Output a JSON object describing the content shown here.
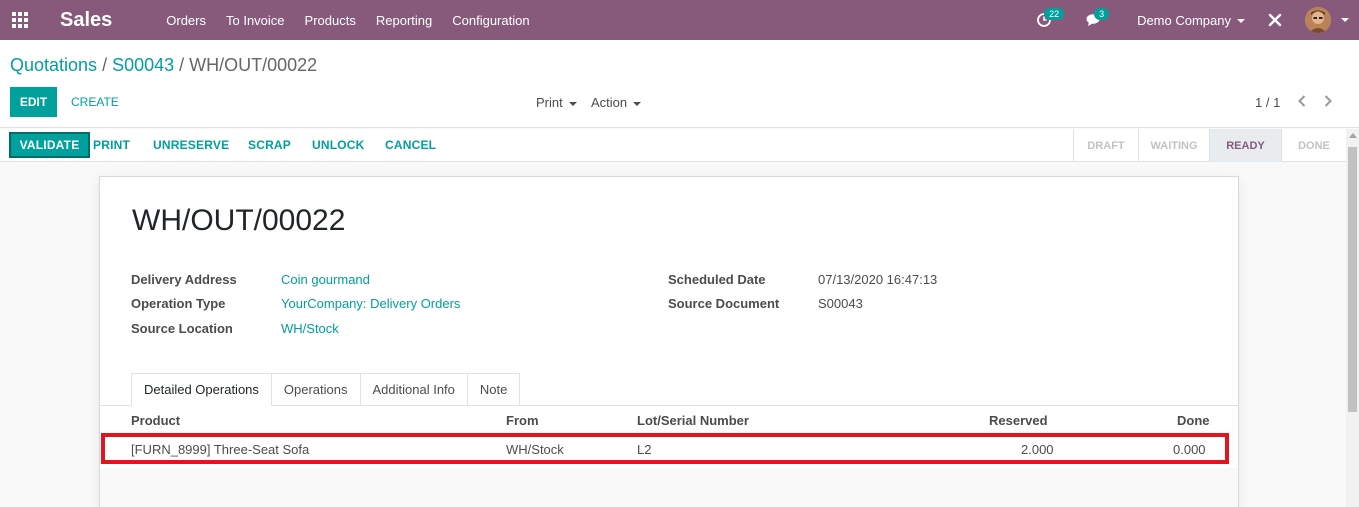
{
  "navbar": {
    "app_name": "Sales",
    "menu": [
      "Orders",
      "To Invoice",
      "Products",
      "Reporting",
      "Configuration"
    ],
    "activity_badge": "22",
    "messages_badge": "3",
    "company": "Demo Company",
    "color": "#875a7b"
  },
  "breadcrumb": {
    "items": [
      "Quotations",
      "S00043"
    ],
    "current": "WH/OUT/00022"
  },
  "control": {
    "edit_label": "EDIT",
    "create_label": "CREATE",
    "print_label": "Print",
    "action_label": "Action",
    "pager": "1 / 1"
  },
  "statusbar": {
    "buttons": [
      "VALIDATE",
      "PRINT",
      "UNRESERVE",
      "SCRAP",
      "UNLOCK",
      "CANCEL"
    ],
    "stages": [
      "DRAFT",
      "WAITING",
      "READY",
      "DONE"
    ],
    "active_stage": "READY"
  },
  "record": {
    "name": "WH/OUT/00022",
    "left_fields": [
      {
        "label": "Delivery Address",
        "value": "Coin gourmand"
      },
      {
        "label": "Operation Type",
        "value": "YourCompany: Delivery Orders"
      },
      {
        "label": "Source Location",
        "value": "WH/Stock"
      }
    ],
    "right_fields": [
      {
        "label": "Scheduled Date",
        "value": "07/13/2020 16:47:13"
      },
      {
        "label": "Source Document",
        "value": "S00043"
      }
    ]
  },
  "tabs": [
    "Detailed Operations",
    "Operations",
    "Additional Info",
    "Note"
  ],
  "table": {
    "columns": [
      "Product",
      "From",
      "Lot/Serial Number",
      "Reserved",
      "Done"
    ],
    "rows": [
      {
        "product": "[FURN_8999] Three-Seat Sofa",
        "from": "WH/Stock",
        "lot": "L2",
        "reserved": "2.000",
        "done": "0.000"
      }
    ]
  },
  "colors": {
    "brand": "#875a7b",
    "accent": "#00a09d",
    "highlight": "#e4141c"
  }
}
